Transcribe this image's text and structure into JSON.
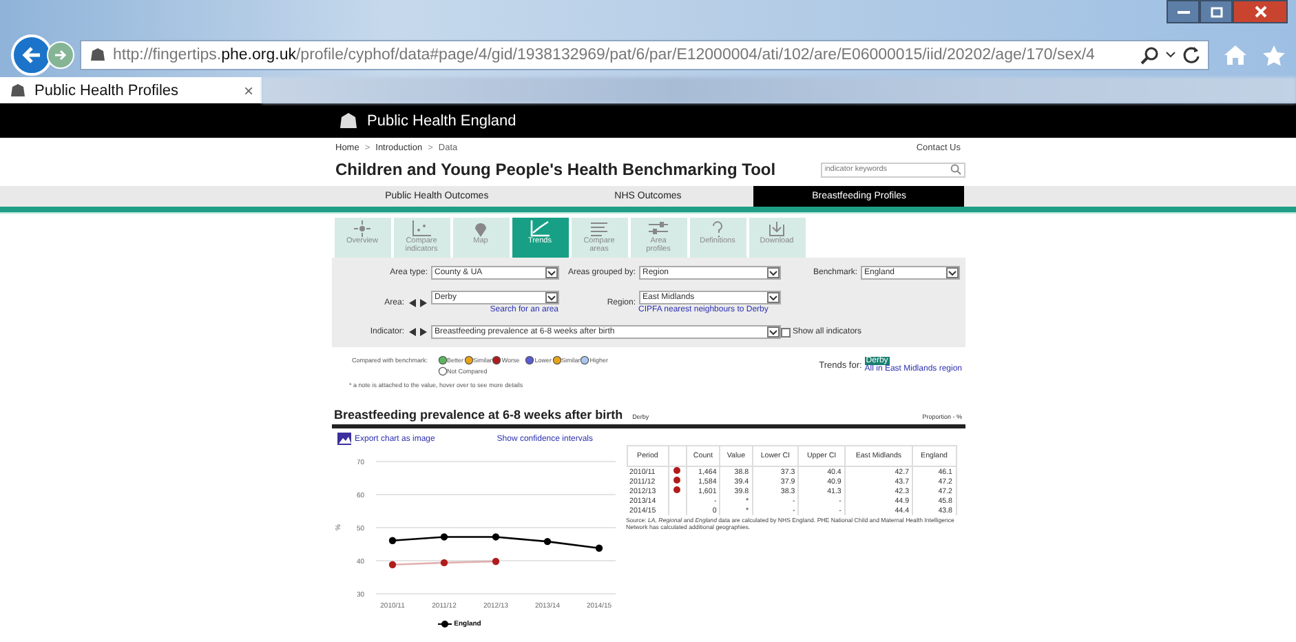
{
  "browser": {
    "address": {
      "prefix": "http://fingertips.",
      "domain": "phe.org.uk",
      "path": "/profile/cyphof/data#page/4/gid/1938132969/pat/6/par/E12000004/ati/102/are/E06000015/iid/20202/age/170/sex/4"
    },
    "tab": {
      "title": "Public Health Profiles",
      "close": "×"
    }
  },
  "org_bar": {
    "name": "Public Health England"
  },
  "breadcrumb": [
    {
      "kind": "link",
      "text": "Home"
    },
    {
      "kind": "separator",
      "text": ">"
    },
    {
      "kind": "link",
      "text": "Introduction"
    },
    {
      "kind": "separator",
      "text": ">"
    },
    {
      "kind": "current",
      "text": "Data"
    }
  ],
  "contact": "Contact Us",
  "title": "Children and Young People's Health Benchmarking Tool",
  "search": {
    "placeholder": "indicator keywords"
  },
  "nav_tabs": [
    {
      "label": "Public Health Outcomes",
      "selected": false
    },
    {
      "label": "NHS Outcomes",
      "selected": false
    },
    {
      "label": "Breastfeeding Profiles",
      "selected": true
    }
  ],
  "tools": [
    {
      "label": "Overview",
      "selected": false
    },
    {
      "label": "Compare indicators",
      "selected": false
    },
    {
      "label": "Map",
      "selected": false
    },
    {
      "label": "Trends",
      "selected": true
    },
    {
      "label": "Compare areas",
      "selected": false
    },
    {
      "label": "Area profiles",
      "selected": false
    },
    {
      "label": "Definitions",
      "selected": false
    },
    {
      "label": "Download",
      "selected": false
    }
  ],
  "controls": {
    "area_type": {
      "label": "Area type:",
      "value": "County & UA"
    },
    "grouped_by": {
      "label": "Areas grouped by:",
      "value": "Region"
    },
    "benchmark": {
      "label": "Benchmark:",
      "value": "England"
    },
    "area": {
      "label": "Area:",
      "value": "Derby",
      "link": "Search for an area"
    },
    "region": {
      "label": "Region:",
      "value": "East Midlands",
      "link": "CIPFA nearest neighbours to Derby"
    },
    "indicator": {
      "label": "Indicator:",
      "value": "Breastfeeding prevalence at 6-8 weeks after birth"
    },
    "show_all": {
      "label": "Show all indicators",
      "checked": false
    }
  },
  "legend": {
    "label": "Compared with benchmark:",
    "items": [
      {
        "label": "Better",
        "color": "#5cb85c"
      },
      {
        "label": "Similar",
        "color": "#e8a317"
      },
      {
        "label": "Worse",
        "color": "#b01c1c"
      },
      {
        "label": "Lower",
        "color": "#5b5bd6"
      },
      {
        "label": "Similar",
        "color": "#e8a317"
      },
      {
        "label": "Higher",
        "color": "#a8c6f0"
      },
      {
        "label": "Not Compared",
        "color": "#ffffff"
      }
    ],
    "note": "* a note is attached to the value, hover over to see more details"
  },
  "trends_for": {
    "label": "Trends for:",
    "options": [
      {
        "label": "Derby",
        "selected": true
      },
      {
        "label": "All in East Midlands region",
        "selected": false
      }
    ]
  },
  "section": {
    "title": "Breastfeeding prevalence at 6-8 weeks after birth",
    "area": "Derby",
    "unit": "Proportion - %",
    "export": "Export chart as image",
    "ci": "Show confidence intervals",
    "chart_data": {
      "type": "line",
      "ylabel": "%",
      "categories": [
        "2010/11",
        "2011/12",
        "2012/13",
        "2013/14",
        "2014/15"
      ],
      "ylim": [
        30,
        70
      ],
      "yticks": [
        30,
        40,
        50,
        60,
        70
      ],
      "grid": true,
      "series": [
        {
          "name": "England",
          "color": "#000000",
          "marker": "circle",
          "values": [
            46.1,
            47.2,
            47.2,
            45.8,
            43.8
          ]
        },
        {
          "color": "#b01c1c",
          "marker": "circle",
          "values": [
            38.8,
            39.4,
            39.8,
            null,
            null
          ]
        }
      ]
    },
    "table": {
      "columns": [
        "Period",
        "",
        "Count",
        "Value",
        "Lower CI",
        "Upper CI",
        "East Midlands",
        "England"
      ],
      "rows": [
        {
          "period": "2010/11",
          "color": "#b01c1c",
          "count": "1,464",
          "value": "38.8",
          "lower": "37.3",
          "upper": "40.4",
          "region": "42.7",
          "england": "46.1"
        },
        {
          "period": "2011/12",
          "color": "#b01c1c",
          "count": "1,584",
          "value": "39.4",
          "lower": "37.9",
          "upper": "40.9",
          "region": "43.7",
          "england": "47.2"
        },
        {
          "period": "2012/13",
          "color": "#b01c1c",
          "count": "1,601",
          "value": "39.8",
          "lower": "38.3",
          "upper": "41.3",
          "region": "42.3",
          "england": "47.2"
        },
        {
          "period": "2013/14",
          "count": "-",
          "value": "*",
          "lower": "-",
          "upper": "-",
          "region": "44.9",
          "england": "45.8"
        },
        {
          "period": "2014/15",
          "count": "0",
          "value": "*",
          "lower": "-",
          "upper": "-",
          "region": "44.4",
          "england": "43.8"
        }
      ],
      "source": "Source: *LA, Regional* and *England* data are calculated by NHS England. PHE National Child and Maternal Health Intelligence Network has calculated additional geographies."
    }
  }
}
